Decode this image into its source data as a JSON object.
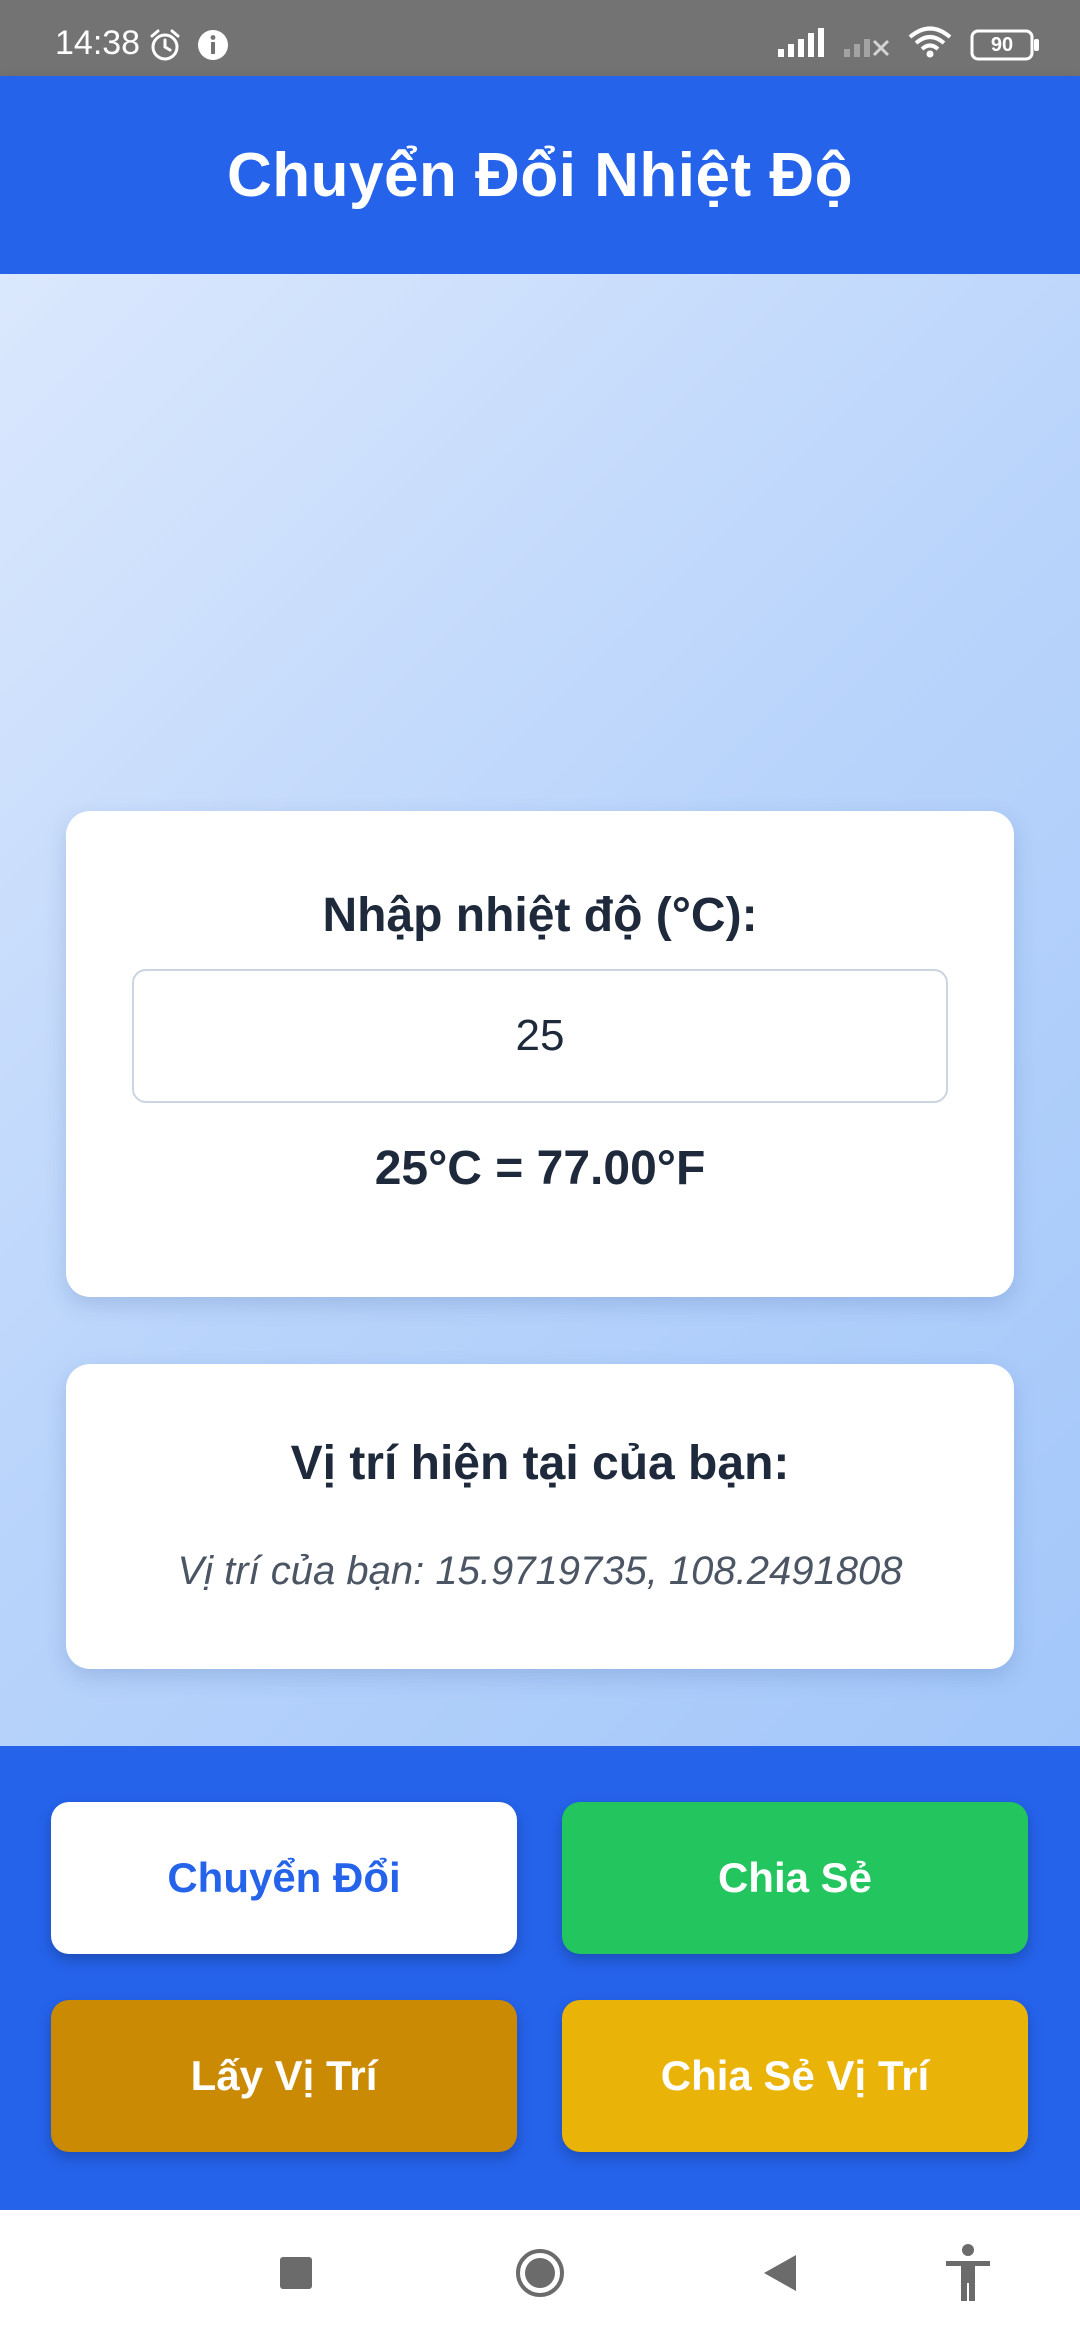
{
  "status_bar": {
    "time": "14:38",
    "battery": "90",
    "icons": [
      "alarm-icon",
      "info-icon",
      "signal-icon",
      "signal-off-icon",
      "wifi-icon",
      "battery-icon"
    ]
  },
  "app_bar": {
    "title": "Chuyển Đổi Nhiệt Độ"
  },
  "temperature_card": {
    "label": "Nhập nhiệt độ (°C):",
    "input_value": "25",
    "result": "25°C = 77.00°F"
  },
  "location_card": {
    "heading": "Vị trí hiện tại của bạn:",
    "text": "Vị trí của bạn: 15.9719735, 108.2491808"
  },
  "buttons": {
    "convert": "Chuyển Đổi",
    "share": "Chia Sẻ",
    "get_location": "Lấy Vị Trí",
    "share_location": "Chia Sẻ Vị Trí"
  },
  "nav": {
    "icons": [
      "recents-square-icon",
      "home-circle-icon",
      "back-triangle-icon",
      "accessibility-icon"
    ]
  },
  "colors": {
    "primary": "#2563eb",
    "success": "#22c55e",
    "amber_dark": "#ca8a04",
    "amber": "#eab308",
    "status_bar": "#737373"
  }
}
